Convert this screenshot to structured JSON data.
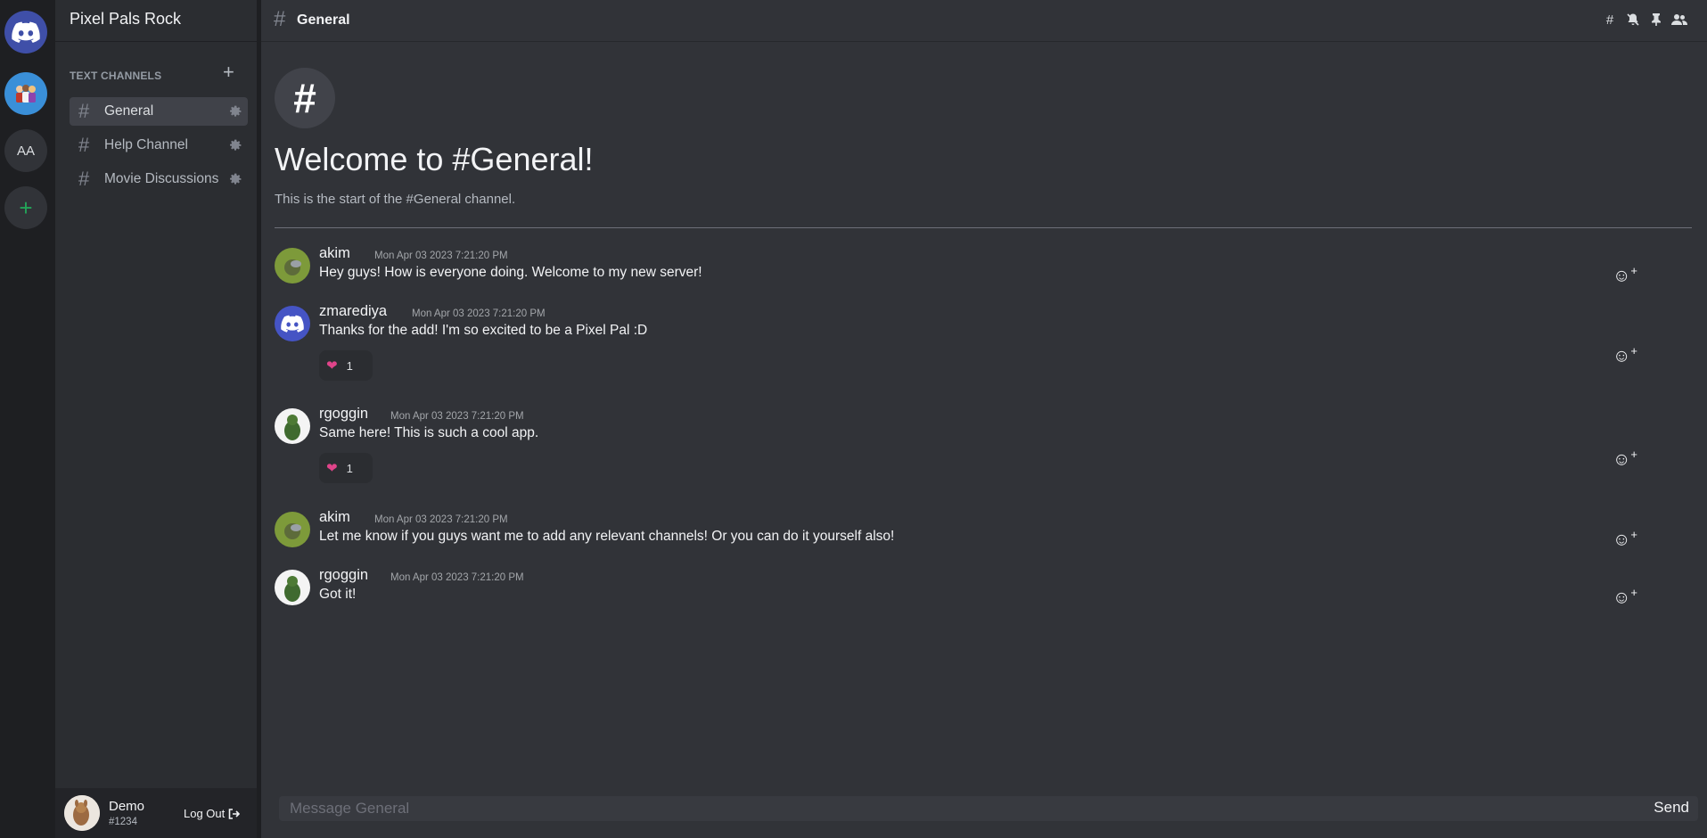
{
  "server": {
    "name": "Pixel Pals Rock"
  },
  "rail": {
    "servers": [
      {
        "label": "AA"
      }
    ]
  },
  "sidebar": {
    "category_label": "TEXT CHANNELS",
    "channels": [
      {
        "name": "General",
        "active": true
      },
      {
        "name": "Help Channel",
        "active": false
      },
      {
        "name": "Movie Discussions",
        "active": false
      }
    ]
  },
  "user": {
    "name": "Demo",
    "tag": "#1234",
    "logout_label": "Log Out"
  },
  "header": {
    "channel_name": "General"
  },
  "welcome": {
    "title": "Welcome to #General!",
    "subtitle": "This is the start of the #General channel."
  },
  "messages": [
    {
      "author": "akim",
      "time": "Mon Apr 03 2023 7:21:20 PM",
      "text": "Hey guys! How is everyone doing. Welcome to my new server!"
    },
    {
      "author": "zmarediya",
      "time": "Mon Apr 03 2023 7:21:20 PM",
      "text": "Thanks for the add! I'm so excited to be a Pixel Pal :D",
      "reaction_count": "1"
    },
    {
      "author": "rgoggin",
      "time": "Mon Apr 03 2023 7:21:20 PM",
      "text": "Same here! This is such a cool app.",
      "reaction_count": "1"
    },
    {
      "author": "akim",
      "time": "Mon Apr 03 2023 7:21:20 PM",
      "text": "Let me know if you guys want me to add any relevant channels! Or you can do it yourself also!"
    },
    {
      "author": "rgoggin",
      "time": "Mon Apr 03 2023 7:21:20 PM",
      "text": "Got it!"
    }
  ],
  "composer": {
    "placeholder": "Message General",
    "send_label": "Send"
  },
  "colors": {
    "accent": "#5865f2",
    "add_server": "#23a559",
    "reaction": "#e0448a"
  }
}
